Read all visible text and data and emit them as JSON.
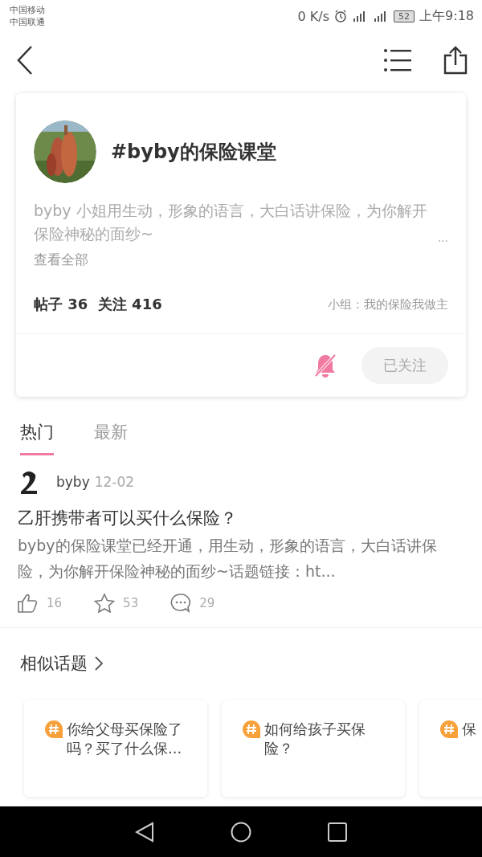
{
  "status_bar": {
    "carriers": [
      "中国移动",
      "中国联通"
    ],
    "speed": "0 K/s",
    "battery": "52",
    "time": "上午9:18"
  },
  "topic": {
    "title": "#byby的保险课堂",
    "description": "byby 小姐用生动，形象的语言，大白话讲保险，为你解开保险神秘的面纱~",
    "more": "...",
    "view_all": "查看全部",
    "stats": "帖子 36  关注 416",
    "group": "小组：我的保险我做主",
    "muted": true,
    "follow_button": "已关注"
  },
  "tabs": [
    {
      "label": "热门",
      "selected": true
    },
    {
      "label": "最新",
      "selected": false
    }
  ],
  "post": {
    "author": "byby",
    "date": "12-02",
    "title": "乙肝携带者可以买什么保险？",
    "excerpt": "byby的保险课堂已经开通，用生动，形象的语言，大白话讲保险，为你解开保险神秘的面纱~话题链接：ht...",
    "likes": "16",
    "stars": "53",
    "comments": "29"
  },
  "similar": {
    "title": "相似话题",
    "topics": [
      "你给父母买保险了吗？买了什么保...",
      "如何给孩子买保险？",
      "保"
    ]
  }
}
